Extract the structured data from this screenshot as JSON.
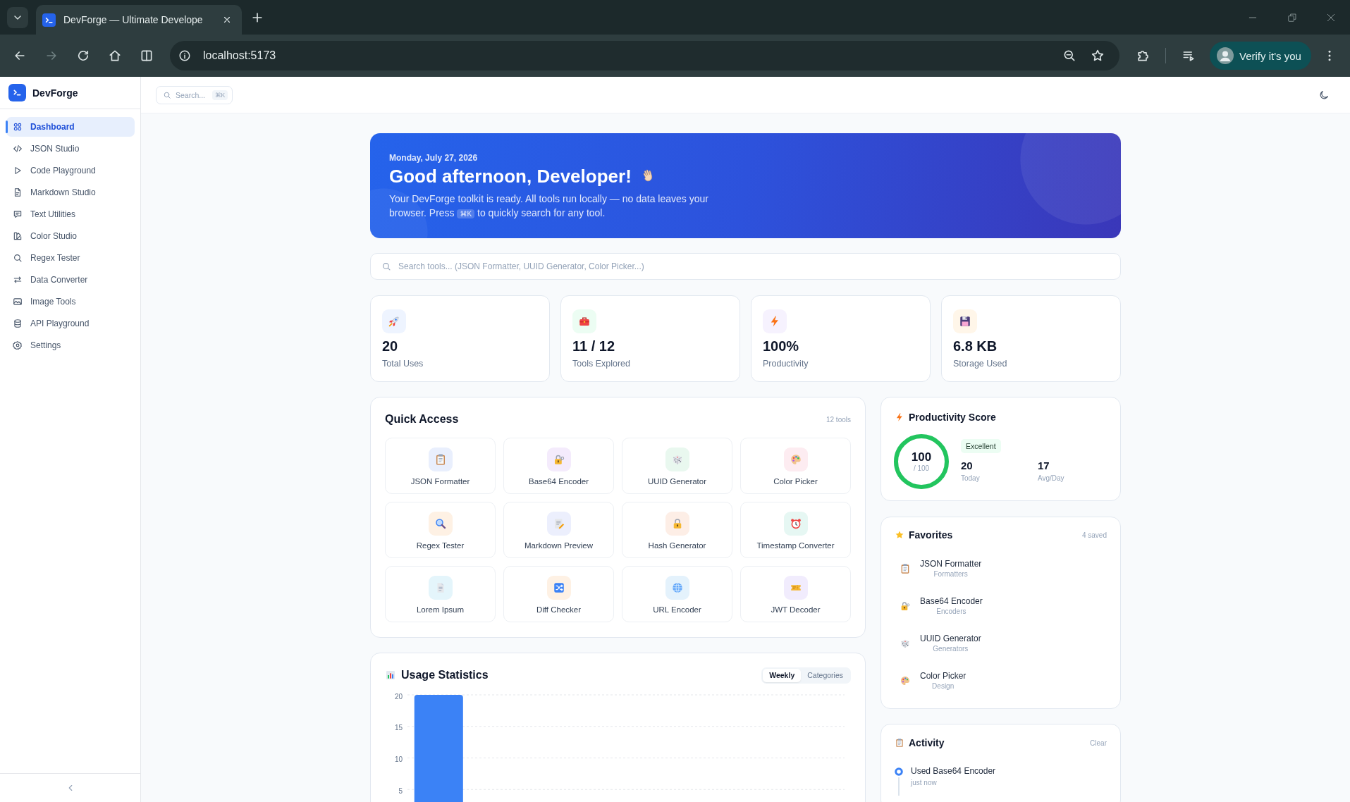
{
  "browser": {
    "tab_title": "DevForge — Ultimate Develope",
    "url": "localhost:5173",
    "forward_disabled": true,
    "profile_label": "Verify it's you"
  },
  "sidebar": {
    "brand": "DevForge",
    "items": [
      {
        "label": "Dashboard",
        "selected": true
      },
      {
        "label": "JSON Studio",
        "selected": false
      },
      {
        "label": "Code Playground",
        "selected": false
      },
      {
        "label": "Markdown Studio",
        "selected": false
      },
      {
        "label": "Text Utilities",
        "selected": false
      },
      {
        "label": "Color Studio",
        "selected": false
      },
      {
        "label": "Regex Tester",
        "selected": false
      },
      {
        "label": "Data Converter",
        "selected": false
      },
      {
        "label": "Image Tools",
        "selected": false
      },
      {
        "label": "API Playground",
        "selected": false
      },
      {
        "label": "Settings",
        "selected": false
      }
    ]
  },
  "header": {
    "search_label": "Search...",
    "search_shortcut": "⌘K"
  },
  "hero": {
    "date": "Monday, July 27, 2026",
    "greeting": "Good afternoon, Developer!",
    "description_start": "Your DevForge toolkit is ready. All tools run locally — no data leaves your browser. Press",
    "shortcut": "⌘K",
    "description_end": "to quickly search for any tool."
  },
  "tool_search": {
    "placeholder": "Search tools... (JSON Formatter, UUID Generator, Color Picker...)"
  },
  "stats": [
    {
      "value": "20",
      "label": "Total Uses"
    },
    {
      "value": "11 / 12",
      "label": "Tools Explored"
    },
    {
      "value": "100%",
      "label": "Productivity"
    },
    {
      "value": "6.8 KB",
      "label": "Storage Used"
    }
  ],
  "quick_access": {
    "title": "Quick Access",
    "count": "12 tools",
    "tools": [
      "JSON Formatter",
      "Base64 Encoder",
      "UUID Generator",
      "Color Picker",
      "Regex Tester",
      "Markdown Preview",
      "Hash Generator",
      "Timestamp Converter",
      "Lorem Ipsum",
      "Diff Checker",
      "URL Encoder",
      "JWT Decoder"
    ]
  },
  "usage_statistics": {
    "title": "Usage Statistics",
    "tabs": [
      {
        "label": "Weekly",
        "selected": true
      },
      {
        "label": "Categories",
        "selected": false
      }
    ],
    "chart_data": {
      "type": "bar",
      "values": [
        20,
        0,
        0,
        0,
        0,
        0,
        0
      ],
      "ylim": [
        0,
        20
      ],
      "yticks": [
        5,
        10,
        15,
        20
      ],
      "grid": true
    }
  },
  "productivity_score": {
    "title": "Productivity Score",
    "score": "100",
    "out_of": "/ 100",
    "level": 1,
    "rating": "Excellent",
    "metrics": [
      {
        "value": "20",
        "label": "Today"
      },
      {
        "value": "17",
        "label": "Avg/Day"
      }
    ]
  },
  "favorites": {
    "title": "Favorites",
    "count": "4 saved",
    "items": [
      {
        "name": "JSON Formatter",
        "category": "Formatters"
      },
      {
        "name": "Base64 Encoder",
        "category": "Encoders"
      },
      {
        "name": "UUID Generator",
        "category": "Generators"
      },
      {
        "name": "Color Picker",
        "category": "Design"
      }
    ]
  },
  "activity": {
    "title": "Activity",
    "action": "Clear",
    "items": [
      {
        "text": "Used Base64 Encoder",
        "time": "just now"
      }
    ]
  }
}
